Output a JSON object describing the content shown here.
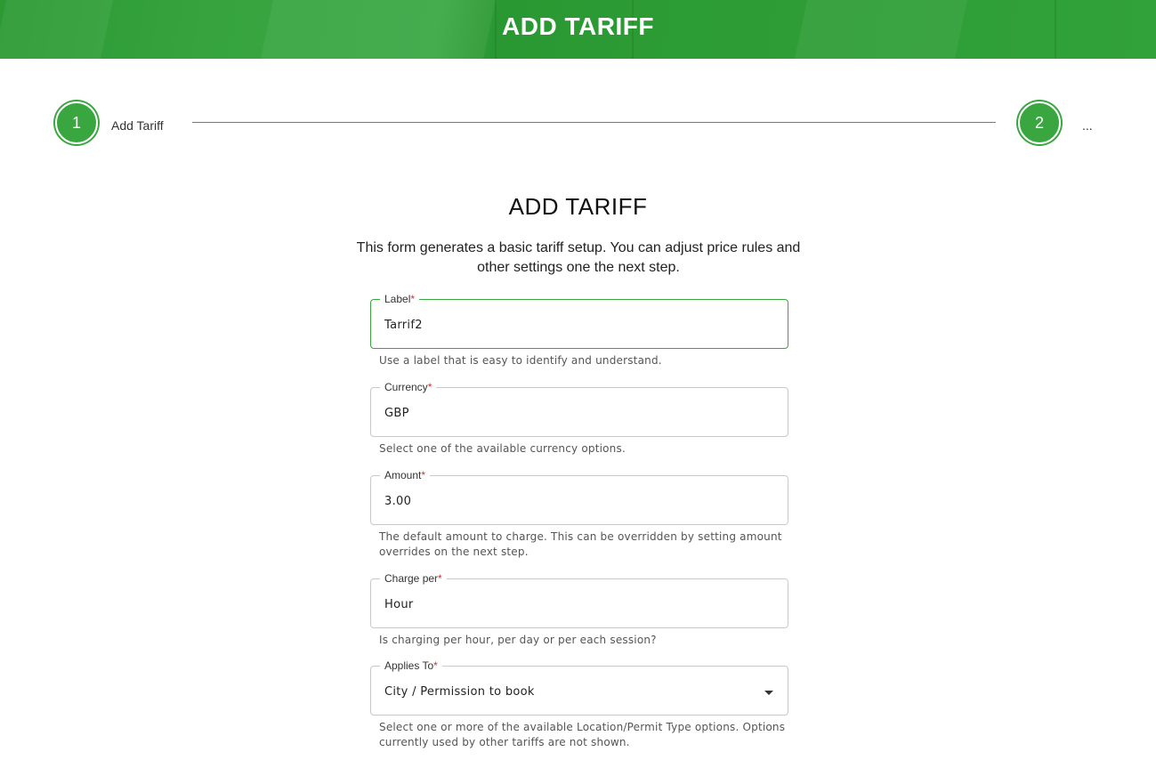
{
  "header": {
    "title": "ADD TARIFF"
  },
  "stepper": {
    "steps": [
      {
        "number": "1",
        "label": "Add Tariff"
      },
      {
        "number": "2",
        "label": "..."
      }
    ]
  },
  "form": {
    "title": "ADD TARIFF",
    "description": "This form generates a basic tariff setup. You can adjust price rules and other settings one the next step.",
    "fields": [
      {
        "label": "Label",
        "required_mark": "*",
        "value": "Tarrif2",
        "hint": "Use a label that is easy to identify and understand."
      },
      {
        "label": "Currency",
        "required_mark": "*",
        "value": "GBP",
        "hint": "Select one of the available currency options."
      },
      {
        "label": "Amount",
        "required_mark": "*",
        "value": "3.00",
        "hint": "The default amount to charge. This can be overridden by setting amount overrides on the next step."
      },
      {
        "label": "Charge per",
        "required_mark": "*",
        "value": "Hour",
        "hint": "Is charging per hour, per day or per each session?"
      },
      {
        "label": "Applies To",
        "required_mark": "*",
        "value": "City / Permission to book",
        "hint": "Select one or more of the available Location/Permit Type options. Options currently used by other tariffs are not shown."
      }
    ]
  },
  "colors": {
    "brand_green": "#3aa640",
    "required_red": "#d32f2f"
  },
  "icons": {
    "applies_to_dropdown": "caret-down-icon"
  }
}
